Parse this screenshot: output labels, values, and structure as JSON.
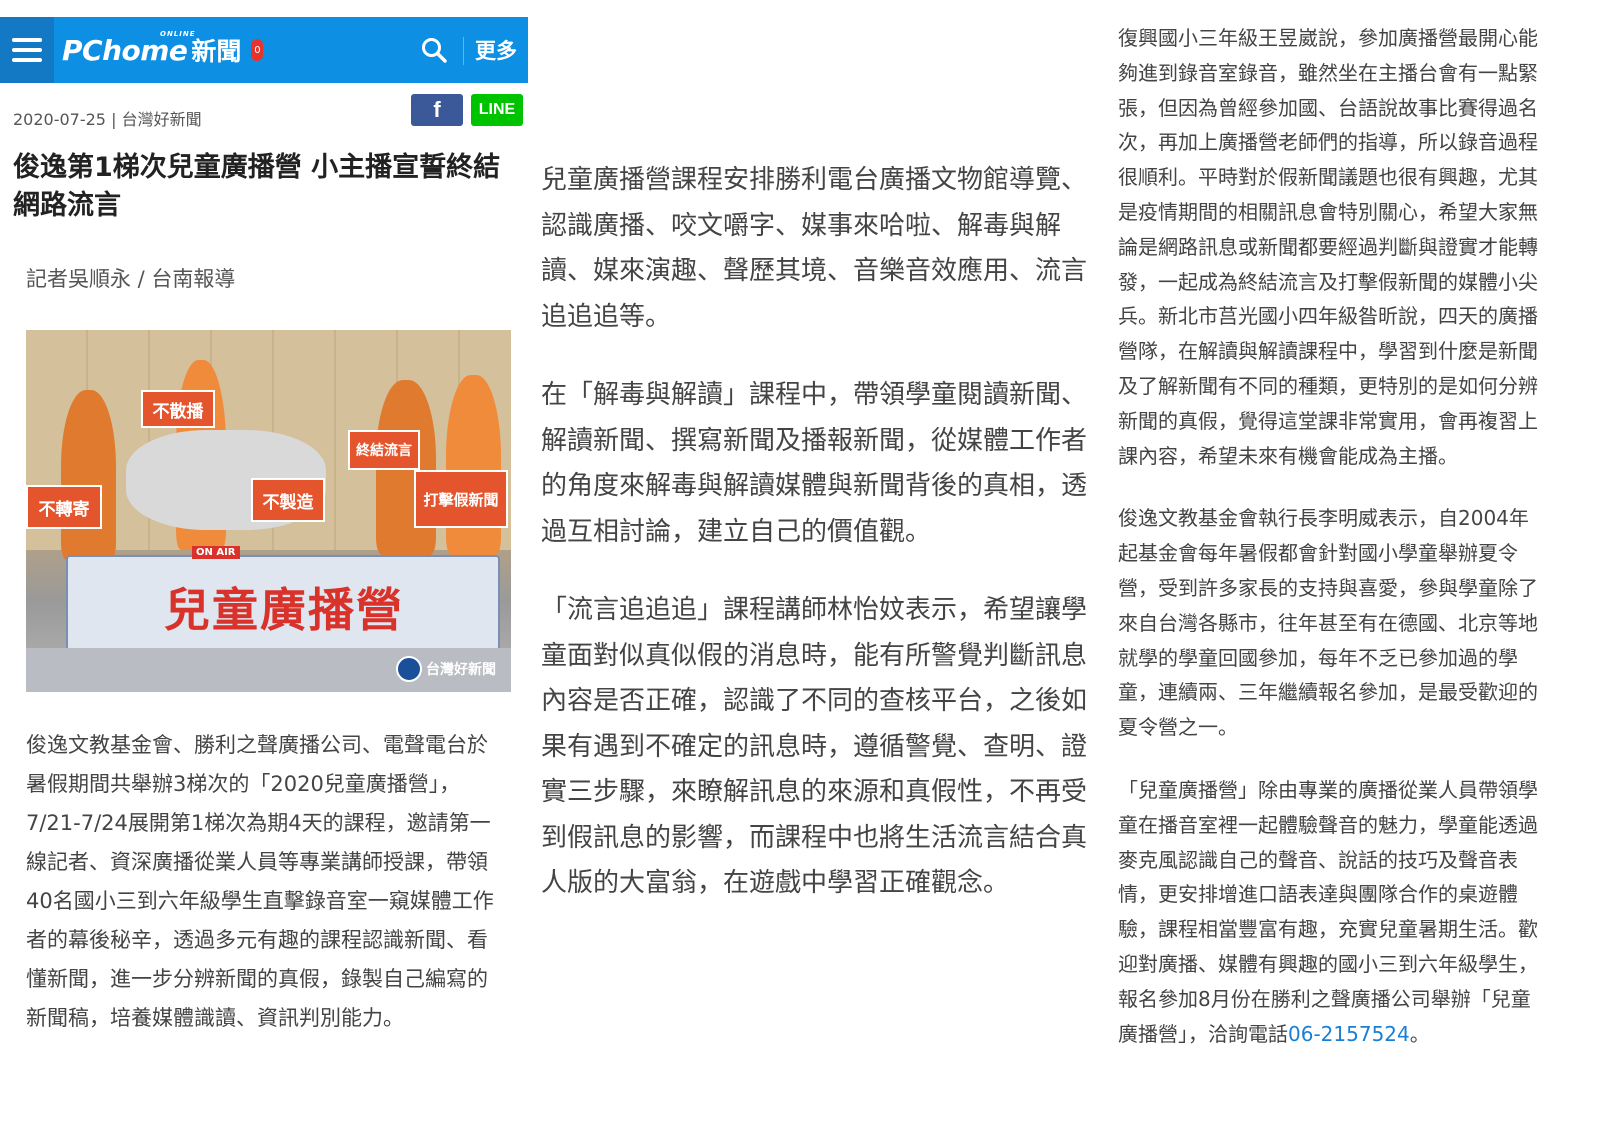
{
  "header": {
    "brand_main": "PChome",
    "brand_online": "ONLINE",
    "brand_news": "新聞",
    "notification_count": "0",
    "more_label": "更多"
  },
  "article": {
    "date": "2020-07-25",
    "source": "台灣好新聞",
    "share_facebook": "f",
    "share_line": "LINE",
    "title": "俊逸第1梯次兒童廣播營 小主播宣誓終結網路流言",
    "byline": "記者吳順永 / 台南報導",
    "photo": {
      "banner_text": "兒童廣播營",
      "on_air": "ON AIR",
      "signs": [
        "不散播",
        "終結流言",
        "不轉寄",
        "不製造",
        "打擊假新聞"
      ],
      "watermark": "台灣好新聞"
    },
    "paragraphs_col1": [
      "俊逸文教基金會、勝利之聲廣播公司、電聲電台於暑假期間共舉辦3梯次的「2020兒童廣播營」，7/21-7/24展開第1梯次為期4天的課程，邀請第一線記者、資深廣播從業人員等專業講師授課，帶領40名國小三到六年級學生直擊錄音室一窺媒體工作者的幕後秘辛，透過多元有趣的課程認識新聞、看懂新聞，進一步分辨新聞的真假，錄製自己編寫的新聞稿，培養媒體識讀、資訊判別能力。"
    ],
    "paragraphs_col2": [
      "兒童廣播營課程安排勝利電台廣播文物館導覽、認識廣播、咬文嚼字、媒事來哈啦、解毒與解讀、媒來演趣、聲歷其境、音樂音效應用、流言追追追等。",
      "在「解毒與解讀」課程中，帶領學童閱讀新聞、解讀新聞、撰寫新聞及播報新聞，從媒體工作者的角度來解毒與解讀媒體與新聞背後的真相，透過互相討論，建立自己的價值觀。",
      "「流言追追追」課程講師林怡妏表示，希望讓學童面對似真似假的消息時，能有所警覺判斷訊息內容是否正確，認識了不同的查核平台，之後如果有遇到不確定的訊息時，遵循警覺、查明、證實三步驟，來瞭解訊息的來源和真假性，不再受到假訊息的影響，而課程中也將生活流言結合真人版的大富翁，在遊戲中學習正確觀念。"
    ],
    "paragraphs_col3": [
      "復興國小三年級王昱崴說，參加廣播營最開心能夠進到錄音室錄音，雖然坐在主播台會有一點緊張，但因為曾經參加國、台語說故事比賽得過名次，再加上廣播營老師們的指導，所以錄音過程很順利。平時對於假新聞議題也很有興趣，尤其是疫情期間的相關訊息會特別關心，希望大家無論是網路訊息或新聞都要經過判斷與證實才能轉發，一起成為終結流言及打擊假新聞的媒體小尖兵。新北市莒光國小四年級昝昕說，四天的廣播營隊，在解讀與解讀課程中，學習到什麼是新聞及了解新聞有不同的種類，更特別的是如何分辨新聞的真假，覺得這堂課非常實用，會再複習上課內容，希望未來有機會能成為主播。",
      "俊逸文教基金會執行長李明威表示，自2004年起基金會每年暑假都會針對國小學童舉辦夏令營，受到許多家長的支持與喜愛，參與學童除了來自台灣各縣市，往年甚至有在德國、北京等地就學的學童回國參加，每年不乏已參加過的學童，連續兩、三年繼續報名參加，是最受歡迎的夏令營之一。"
    ],
    "last_paragraph_text": "「兒童廣播營」除由專業的廣播從業人員帶領學童在播音室裡一起體驗聲音的魅力，學童能透過麥克風認識自己的聲音、說話的技巧及聲音表情，更安排增進口語表達與團隊合作的桌遊體驗，課程相當豐富有趣，充實兒童暑期生活。歡迎對廣播、媒體有興趣的國小三到六年級學生，報名參加8月份在勝利之聲廣播公司舉辦「兒童廣播營」，洽詢電話",
    "phone": "06-2157524",
    "last_paragraph_end": "。"
  },
  "colors": {
    "header_blue": "#0d8fe3",
    "menu_blue": "#1479c4",
    "facebook": "#3b5998",
    "line": "#00c300",
    "link": "#1a7fd4",
    "badge_red": "#e8332a"
  },
  "icons": [
    "hamburger-menu-icon",
    "search-icon",
    "facebook-icon",
    "line-icon"
  ]
}
